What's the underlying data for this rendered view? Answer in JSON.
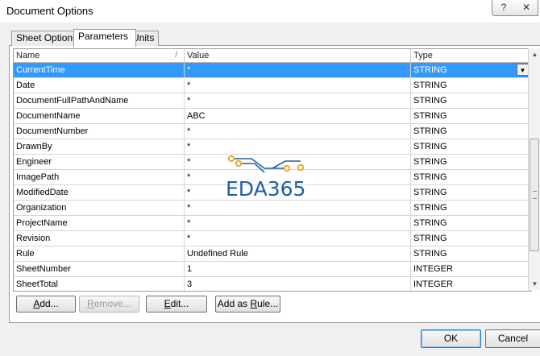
{
  "window": {
    "title": "Document Options",
    "help_glyph": "?",
    "close_glyph": "✕"
  },
  "tabs": [
    {
      "label": "Sheet Options"
    },
    {
      "label": "Parameters"
    },
    {
      "label": "Units"
    }
  ],
  "grid": {
    "columns": [
      "Name",
      "Value",
      "Type"
    ],
    "sort_glyph": "/",
    "dropdown_glyph": "▼",
    "rows": [
      {
        "name": "CurrentTime",
        "value": "*",
        "type": "STRING"
      },
      {
        "name": "Date",
        "value": "*",
        "type": "STRING"
      },
      {
        "name": "DocumentFullPathAndName",
        "value": "*",
        "type": "STRING"
      },
      {
        "name": "DocumentName",
        "value": "ABC",
        "type": "STRING"
      },
      {
        "name": "DocumentNumber",
        "value": "*",
        "type": "STRING"
      },
      {
        "name": "DrawnBy",
        "value": "*",
        "type": "STRING"
      },
      {
        "name": "Engineer",
        "value": "*",
        "type": "STRING"
      },
      {
        "name": "ImagePath",
        "value": "*",
        "type": "STRING"
      },
      {
        "name": "ModifiedDate",
        "value": "*",
        "type": "STRING"
      },
      {
        "name": "Organization",
        "value": "*",
        "type": "STRING"
      },
      {
        "name": "ProjectName",
        "value": "*",
        "type": "STRING"
      },
      {
        "name": "Revision",
        "value": "*",
        "type": "STRING"
      },
      {
        "name": "Rule",
        "value": "Undefined Rule",
        "type": "STRING"
      },
      {
        "name": "SheetNumber",
        "value": "1",
        "type": "INTEGER"
      },
      {
        "name": "SheetTotal",
        "value": "3",
        "type": "INTEGER"
      }
    ],
    "selected_index": 0
  },
  "scrollbar": {
    "up_glyph": "▲",
    "down_glyph": "▼"
  },
  "actions": {
    "add": {
      "pre": "",
      "key": "A",
      "post": "dd..."
    },
    "remove": {
      "pre": "",
      "key": "R",
      "post": "emove..."
    },
    "edit": {
      "pre": "",
      "key": "E",
      "post": "dit..."
    },
    "add_as_rule": {
      "pre": "Add as ",
      "key": "R",
      "post": "ule..."
    }
  },
  "footer": {
    "ok_label": "OK",
    "cancel_label": "Cancel"
  },
  "watermark": {
    "text": "EDA365",
    "color": "#1f5ea8",
    "dot_color": "#f0a830"
  }
}
